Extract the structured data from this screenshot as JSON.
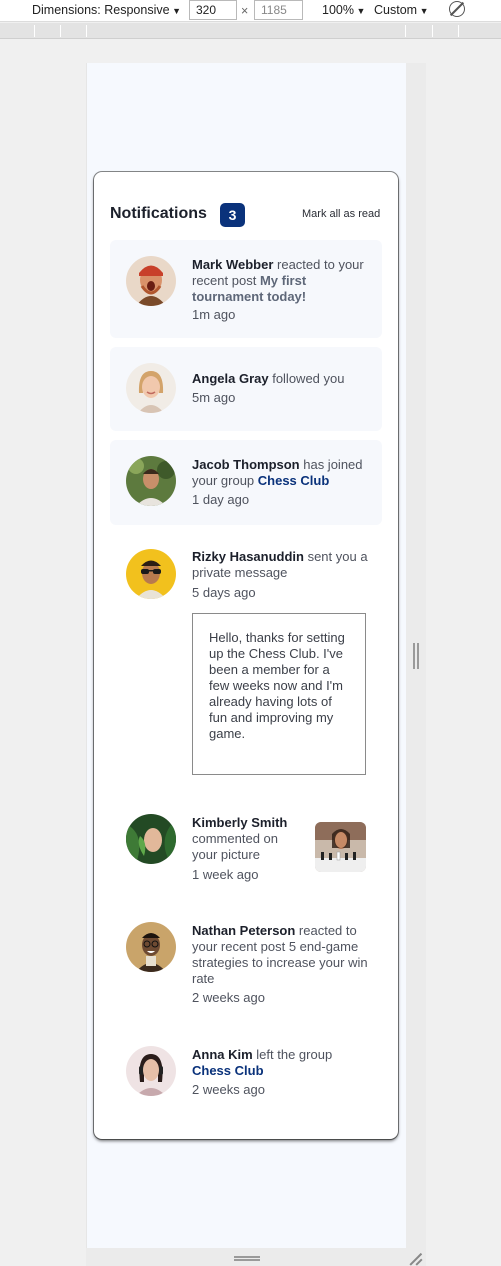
{
  "devtools": {
    "dimensions_label": "Dimensions: Responsive",
    "width_value": "320",
    "times_sign": "×",
    "height_value": "1185",
    "zoom_label": "100%",
    "throttle_label": "Custom"
  },
  "header": {
    "title": "Notifications",
    "unread_count": "3",
    "mark_all_label": "Mark all as read"
  },
  "notifications": [
    {
      "name": "Mark Webber",
      "action": " reacted to your recent post ",
      "post": "My first tournament today!",
      "time": "1m ago",
      "unread": true
    },
    {
      "name": "Angela Gray",
      "action": " followed you",
      "time": "5m ago",
      "unread": true
    },
    {
      "name": "Jacob Thompson",
      "action": " has joined your group ",
      "group": "Chess Club",
      "time": "1 day ago",
      "unread": true
    },
    {
      "name": "Rizky Hasanuddin",
      "action": " sent you a private message",
      "time": "5 days ago",
      "message": "Hello, thanks for setting up the Chess Club. I've been a member for a few weeks now and I'm already having lots of fun and improving my game.",
      "unread": false
    },
    {
      "name": "Kimberly Smith",
      "action": " commented on your picture",
      "time": "1 week ago",
      "unread": false
    },
    {
      "name": "Nathan Peterson",
      "action": " reacted to your recent post 5 end-game strategies to increase your win rate",
      "time": "2 weeks ago",
      "unread": false
    },
    {
      "name": "Anna Kim",
      "action": " left the group ",
      "group": "Chess Club",
      "time": "2 weeks ago",
      "unread": false
    }
  ],
  "colors": {
    "accent_navy": "#0a327b",
    "unread_bg": "#f6f8fc",
    "page_bg": "#f6f9fe"
  }
}
